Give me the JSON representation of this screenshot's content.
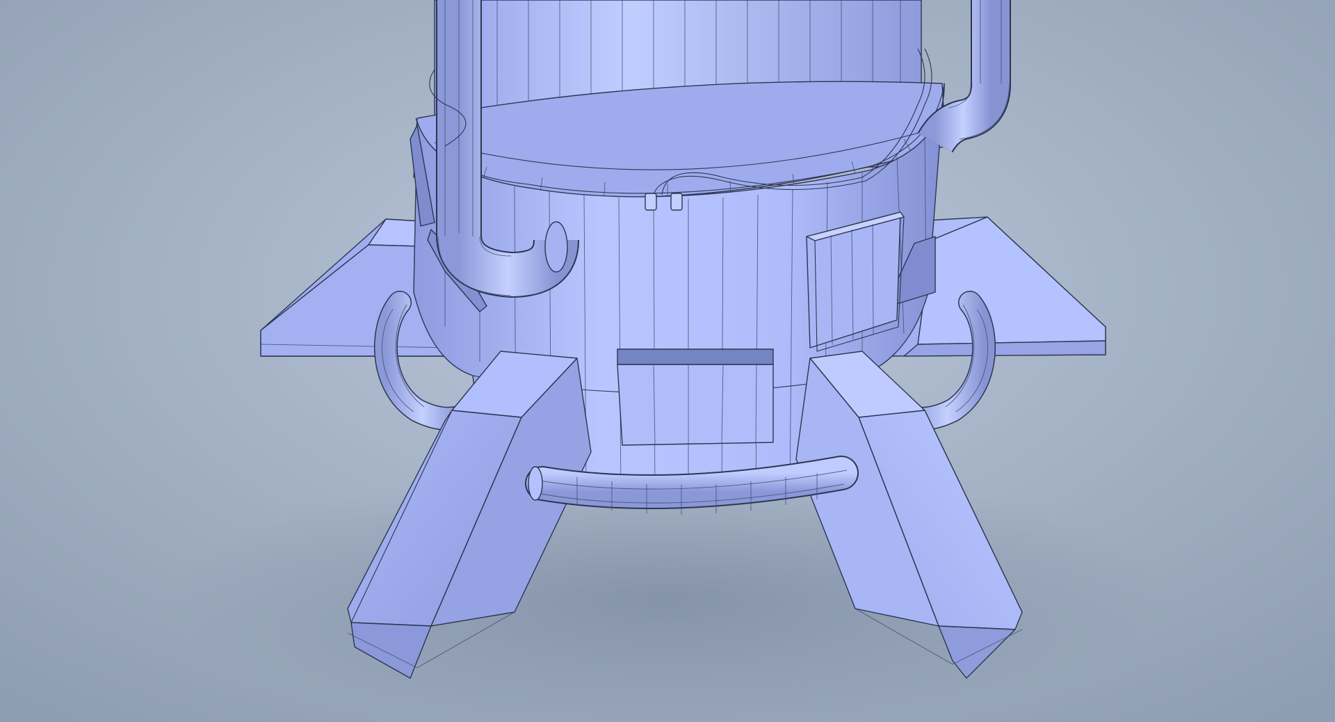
{
  "scene": {
    "subject": "rocket-base",
    "render_style": "wireframe-shaded",
    "background_color": "#9eabbe",
    "model_light": "#c3d0ff",
    "model_mid": "#a5b4f4",
    "model_shadow": "#7e8cca",
    "wire_color": "#2c3550",
    "parts": {
      "legs": 4,
      "side_pipes": 2,
      "ring_pipes": 3,
      "hatches": 2,
      "cable_connectors": 2
    }
  }
}
